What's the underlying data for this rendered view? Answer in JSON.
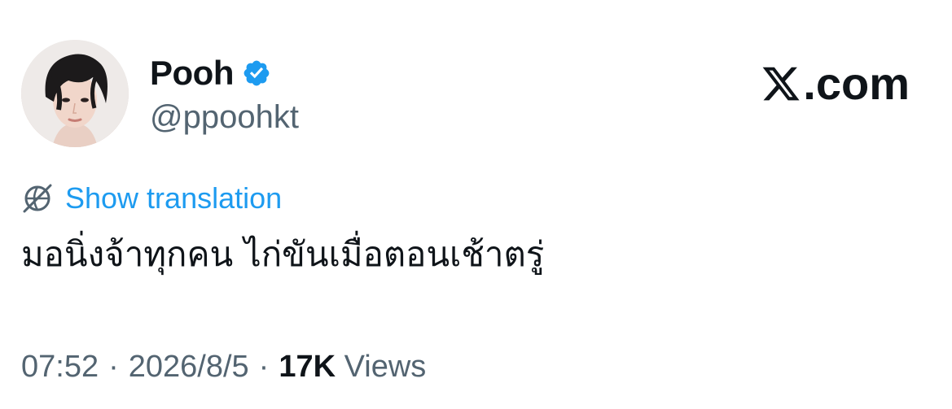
{
  "author": {
    "display_name": "Pooh",
    "handle": "@ppoohkt",
    "verified": true,
    "verified_color": "#1d9bf0"
  },
  "brand": {
    "label": ".com",
    "icon": "x-logo-icon"
  },
  "translation": {
    "label": "Show translation",
    "icon": "globe-icon",
    "color": "#1d9bf0"
  },
  "tweet": {
    "text": "มอนิ่งจ้าทุกคน ไก่ขันเมื่อตอนเช้าตรู่"
  },
  "meta": {
    "time": "07:52",
    "separator1": "·",
    "date": "2026/8/5",
    "separator2": "·",
    "views_count": "17K",
    "views_label": "Views"
  },
  "colors": {
    "text_primary": "#0f1419",
    "text_secondary": "#536471",
    "accent": "#1d9bf0"
  }
}
